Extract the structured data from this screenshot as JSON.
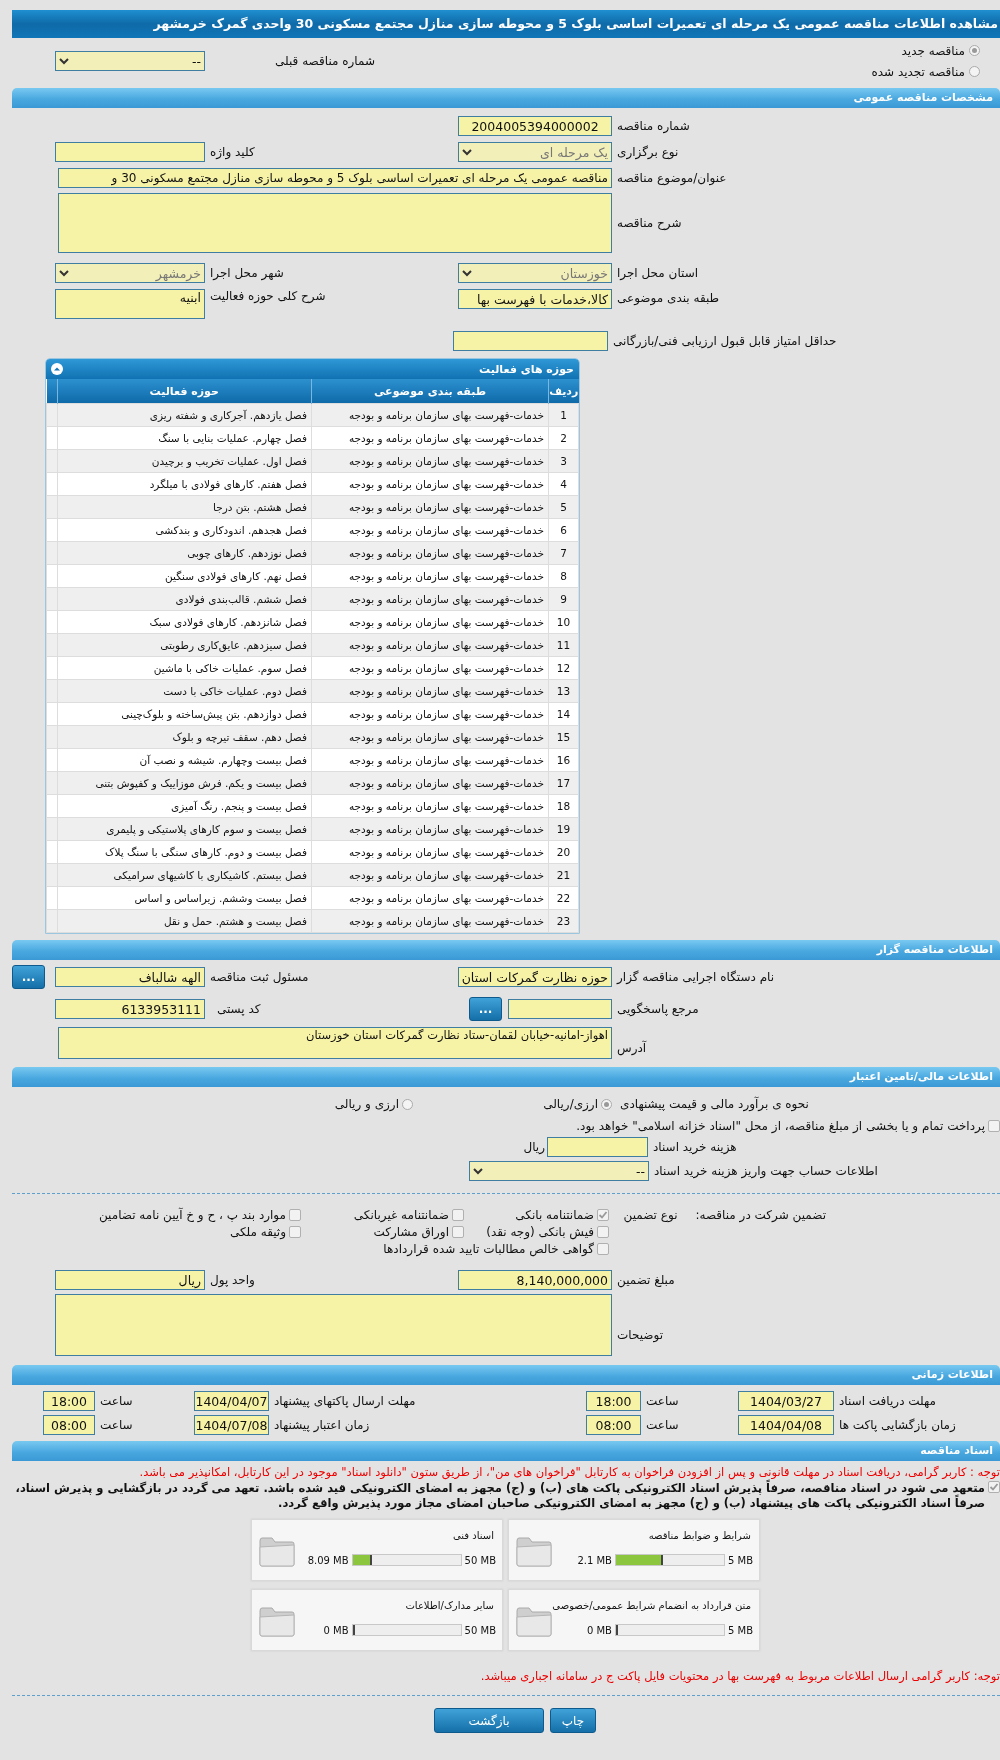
{
  "page_title": "مشاهده اطلاعات مناقصه عمومی یک مرحله ای تعمیرات اساسی بلوک 5 و محوطه سازی منازل مجتمع مسکونی 30 واحدی گمرک خرمشهر",
  "tender_type": [
    {
      "label": "مناقصه جدید",
      "selected": true
    },
    {
      "label": "مناقصه تجدید شده",
      "selected": false
    }
  ],
  "previous_tender": {
    "label": "شماره مناقصه قبلی",
    "value": "--"
  },
  "general": {
    "title": "مشخصات مناقصه عمومی",
    "tender_number": {
      "label": "شماره مناقصه",
      "value": "2004005394000002"
    },
    "holding_type": {
      "label": "نوع برگزاری",
      "value": "یک مرحله ای"
    },
    "keyword": {
      "label": "کلید واژه"
    },
    "subject": {
      "label": "عنوان/موضوع مناقصه",
      "value": "مناقصه عمومی یک مرحله ای تعمیرات اساسی بلوک 5 و محوطه سازی منازل مجتمع مسکونی 30 و"
    },
    "description": {
      "label": "شرح مناقصه"
    },
    "province": {
      "label": "استان محل اجرا",
      "value": "خوزستان"
    },
    "city": {
      "label": "شهر محل اجرا",
      "value": "خرمشهر"
    },
    "category": {
      "label": "طبقه بندی موضوعی",
      "value": "کالا،خدمات با فهرست بها"
    },
    "activity_scope": {
      "label": "شرح کلی حوزه فعالیت",
      "value": "ابنیه"
    },
    "min_score": {
      "label": "حداقل امتیاز قابل قبول ارزیابی فنی/بازرگانی"
    }
  },
  "activities": {
    "title": "حوزه های فعالیت",
    "columns": [
      "ردیف",
      "طبقه بندی موضوعی",
      "حوزه فعالیت"
    ],
    "rows": [
      {
        "number": "1",
        "category": "خدمات-فهرست بهای سازمان برنامه و بودجه",
        "activity": "فصل یازدهم. آجرکاری و شفته ریزی"
      },
      {
        "number": "2",
        "category": "خدمات-فهرست بهای سازمان برنامه و بودجه",
        "activity": "فصل چهارم. عملیات بنایی با سنگ"
      },
      {
        "number": "3",
        "category": "خدمات-فهرست بهای سازمان برنامه و بودجه",
        "activity": "فصل اول. عملیات تخریب و برچیدن"
      },
      {
        "number": "4",
        "category": "خدمات-فهرست بهای سازمان برنامه و بودجه",
        "activity": "فصل هفتم. کارهای فولادی با میلگرد"
      },
      {
        "number": "5",
        "category": "خدمات-فهرست بهای سازمان برنامه و بودجه",
        "activity": "فصل هشتم. بتن درجا"
      },
      {
        "number": "6",
        "category": "خدمات-فهرست بهای سازمان برنامه و بودجه",
        "activity": "فصل هجدهم. اندودکاری و بندکشی"
      },
      {
        "number": "7",
        "category": "خدمات-فهرست بهای سازمان برنامه و بودجه",
        "activity": "فصل نوزدهم. کارهای چوبی"
      },
      {
        "number": "8",
        "category": "خدمات-فهرست بهای سازمان برنامه و بودجه",
        "activity": "فصل نهم. کارهای فولادی سنگین"
      },
      {
        "number": "9",
        "category": "خدمات-فهرست بهای سازمان برنامه و بودجه",
        "activity": "فصل ششم. قالب‌بندی فولادی"
      },
      {
        "number": "10",
        "category": "خدمات-فهرست بهای سازمان برنامه و بودجه",
        "activity": "فصل شانزدهم. کارهای فولادی سبک"
      },
      {
        "number": "11",
        "category": "خدمات-فهرست بهای سازمان برنامه و بودجه",
        "activity": "فصل سیزدهم. عایق‌کاری رطوبتی"
      },
      {
        "number": "12",
        "category": "خدمات-فهرست بهای سازمان برنامه و بودجه",
        "activity": "فصل سوم. عملیات خاکی با ماشین"
      },
      {
        "number": "13",
        "category": "خدمات-فهرست بهای سازمان برنامه و بودجه",
        "activity": "فصل دوم. عملیات خاکی با دست"
      },
      {
        "number": "14",
        "category": "خدمات-فهرست بهای سازمان برنامه و بودجه",
        "activity": "فصل دوازدهم. بتن پیش‌ساخته و بلوک‌چینی"
      },
      {
        "number": "15",
        "category": "خدمات-فهرست بهای سازمان برنامه و بودجه",
        "activity": "فصل دهم. سقف تیرچه و بلوک"
      },
      {
        "number": "16",
        "category": "خدمات-فهرست بهای سازمان برنامه و بودجه",
        "activity": "فصل بیست وچهارم. شیشه و نصب آن"
      },
      {
        "number": "17",
        "category": "خدمات-فهرست بهای سازمان برنامه و بودجه",
        "activity": "فصل بیست و یکم. فرش موزاییک و کفپوش بتنی"
      },
      {
        "number": "18",
        "category": "خدمات-فهرست بهای سازمان برنامه و بودجه",
        "activity": "فصل بیست و پنجم. رنگ آمیزی"
      },
      {
        "number": "19",
        "category": "خدمات-فهرست بهای سازمان برنامه و بودجه",
        "activity": "فصل بیست و سوم کارهای پلاستیکی و پلیمری"
      },
      {
        "number": "20",
        "category": "خدمات-فهرست بهای سازمان برنامه و بودجه",
        "activity": "فصل بیست و دوم. کارهای سنگی با سنگ پلاک"
      },
      {
        "number": "21",
        "category": "خدمات-فهرست بهای سازمان برنامه و بودجه",
        "activity": "فصل بیستم. کاشیکاری با کاشیهای سرامیکی"
      },
      {
        "number": "22",
        "category": "خدمات-فهرست بهای سازمان برنامه و بودجه",
        "activity": "فصل بیست وششم. زیراساس و اساس"
      },
      {
        "number": "23",
        "category": "خدمات-فهرست بهای سازمان برنامه و بودجه",
        "activity": "فصل بیست و هشتم. حمل و نقل"
      }
    ]
  },
  "organizer": {
    "title": "اطلاعات مناقصه گزار",
    "agency": {
      "label": "نام دستگاه اجرایی مناقصه گزار",
      "value": "حوزه نظارت گمرکات استان"
    },
    "registrar": {
      "label": "مسئول ثبت مناقصه",
      "value": "الهه شالباف",
      "button": "..."
    },
    "responder": {
      "label": "مرجع پاسخگویی",
      "button": "..."
    },
    "postal_code": {
      "label": "کد پستی",
      "value": "6133953111"
    },
    "address": {
      "label": "آدرس",
      "value": "اهواز-امانیه-خیابان لقمان-ستاد نظارت گمرکات استان خوزستان"
    }
  },
  "finance": {
    "title": "اطلاعات مالی/تامین اعتبار",
    "estimate": {
      "label": "نحوه ی برآورد مالی و قیمت پیشنهادی",
      "options": [
        {
          "label": "ارزی/ریالی",
          "selected": true
        },
        {
          "label": "ارزی و ریالی",
          "selected": false
        }
      ]
    },
    "treasury": {
      "label": "پرداخت تمام و یا بخشی از مبلغ مناقصه، از محل \"اسناد خزانه اسلامی\" خواهد بود.",
      "checked": false
    },
    "doc_fee": {
      "label": "هزینه خرید اسناد",
      "unit": "ریال"
    },
    "account": {
      "label": "اطلاعات حساب جهت واریز هزینه خرید اسناد",
      "value": "--"
    }
  },
  "guarantee": {
    "label": "تضمین شرکت در مناقصه:",
    "type_label": "نوع تضمین",
    "options": [
      {
        "label": "ضمانتنامه بانکی",
        "checked": true
      },
      {
        "label": "ضمانتنامه غیربانکی",
        "checked": false
      },
      {
        "label": "موارد بند پ ، ح و خ آیین نامه تضامین",
        "checked": false
      },
      {
        "label": "فیش بانکی (وجه نقد)",
        "checked": false
      },
      {
        "label": "اوراق مشارکت",
        "checked": false
      },
      {
        "label": "وثیقه ملکی",
        "checked": false
      },
      {
        "label": "گواهی خالص مطالبات تایید شده قراردادها",
        "checked": false
      }
    ],
    "amount": {
      "label": "مبلغ تضمین",
      "value": "8,140,000,000"
    },
    "currency": {
      "label": "واحد پول",
      "value": "ریال"
    },
    "notes": {
      "label": "توضیحات"
    }
  },
  "timing": {
    "title": "اطلاعات زمانی",
    "items": [
      {
        "label": "مهلت دریافت اسناد",
        "date": "1404/03/27",
        "time_label": "ساعت",
        "time": "18:00"
      },
      {
        "label": "مهلت ارسال پاکتهای پیشنهاد",
        "date": "1404/04/07",
        "time_label": "ساعت",
        "time": "18:00"
      },
      {
        "label": "زمان بازگشایی پاکت ها",
        "date": "1404/04/08",
        "time_label": "ساعت",
        "time": "08:00"
      },
      {
        "label": "زمان اعتبار پیشنهاد",
        "date": "1404/07/08",
        "time_label": "ساعت",
        "time": "08:00"
      }
    ]
  },
  "documents": {
    "title": "اسناد مناقصه",
    "notice": "توجه : کاربر گرامی، دریافت اسناد در مهلت قانونی و پس از افزودن فراخوان به کارتابل \"فراخوان های من\"، از طریق ستون \"دانلود اسناد\" موجود در این کارتابل، امکانپذیر می باشد.",
    "commitment": {
      "label": "متعهد می شود در اسناد مناقصه، صرفاً پذیرش اسناد الکترونیکی پاکت های (ب) و (ج) مجهز به امضای الکترونیکی قید شده باشد. تعهد می گردد در بازگشایی و پذیرش اسناد، صرفاً اسناد الکترونیکی پاکت های پیشنهاد (ب) و (ج) مجهز به امضای الکترونیکی صاحبان امضای مجاز مورد پذیرش واقع گردد.",
      "checked": true
    },
    "files": [
      {
        "name": "شرایط و ضوابط مناقصه",
        "size": "2.1 MB",
        "max": "5 MB",
        "level": 0.42
      },
      {
        "name": "اسناد فنی",
        "size": "8.09 MB",
        "max": "50 MB",
        "level": 0.16
      },
      {
        "name": "متن قرارداد به انضمام شرایط عمومی/خصوصی",
        "size": "0 MB",
        "max": "5 MB",
        "level": 0
      },
      {
        "name": "سایر مدارک/اطلاعات",
        "size": "0 MB",
        "max": "50 MB",
        "level": 0
      }
    ],
    "footer_note": "توجه: کاربر گرامی ارسال اطلاعات مربوط به فهرست بها در محتویات فایل پاکت ج در سامانه اجباری میباشد."
  },
  "buttons": [
    {
      "label": "چاپ",
      "kind": "print"
    },
    {
      "label": "بازگشت",
      "kind": "back"
    }
  ]
}
